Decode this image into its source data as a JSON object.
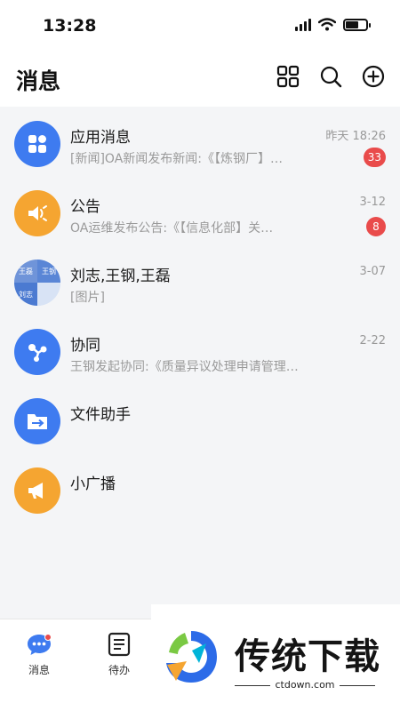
{
  "status": {
    "time": "13:28"
  },
  "header": {
    "title": "消息",
    "actions": [
      {
        "icon": "grid-icon"
      },
      {
        "icon": "search-icon"
      },
      {
        "icon": "add-circle-icon"
      }
    ]
  },
  "messages": [
    {
      "title": "应用消息",
      "time": "昨天 18:26",
      "preview": "[新闻]OA新闻发布新闻:《【炼钢厂】…",
      "badge": "33",
      "icon": "apps-icon",
      "color": "#3e7bf0"
    },
    {
      "title": "公告",
      "time": "3-12",
      "preview": "OA运维发布公告:《【信息化部】关…",
      "badge": "8",
      "icon": "speaker-icon",
      "color": "#f5a531"
    },
    {
      "title": "刘志,王钢,王磊",
      "time": "3-07",
      "preview": "[图片]",
      "badge": "",
      "icon": "group-avatar",
      "color": "#5a86d6",
      "avatar_labels": [
        "王磊",
        "王钢",
        "刘志",
        ""
      ]
    },
    {
      "title": "协同",
      "time": "2-22",
      "preview": "王钢发起协同:《质量异议处理申请管理…",
      "badge": "",
      "icon": "share-icon",
      "color": "#3e7bf0"
    },
    {
      "title": "文件助手",
      "time": "",
      "preview": "",
      "badge": "",
      "icon": "folder-transfer-icon",
      "color": "#3e7bf0"
    },
    {
      "title": "小广播",
      "time": "",
      "preview": "",
      "badge": "",
      "icon": "megaphone-icon",
      "color": "#f5a531"
    }
  ],
  "tabbar": {
    "tabs": [
      {
        "label": "消息",
        "icon": "chat-icon",
        "active": true
      },
      {
        "label": "待办",
        "icon": "todo-list-icon",
        "active": false
      }
    ]
  },
  "watermark": {
    "text": "传统下载",
    "url": "ctdown.com"
  }
}
